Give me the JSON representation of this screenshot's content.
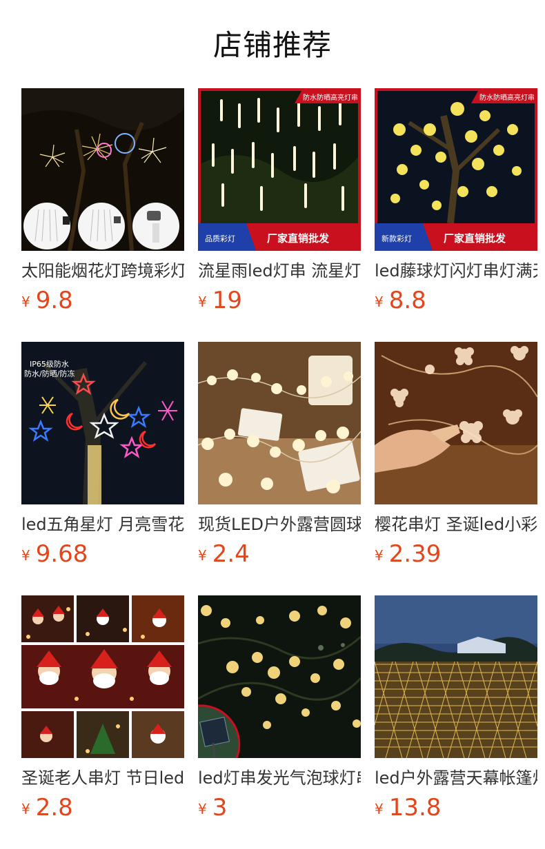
{
  "header": {
    "title": "店铺推荐"
  },
  "colors": {
    "price": "#e2461a",
    "banner_red": "#c8101e",
    "banner_blue": "#1e40a8"
  },
  "products": [
    {
      "name": "太阳能烟花灯跨境彩灯",
      "currency": "¥",
      "price": "9.8",
      "image": "fireworks-lights-photo"
    },
    {
      "name": "流星雨led灯串 流星灯",
      "currency": "¥",
      "price": "19",
      "image": "meteor-rain-lights-photo",
      "top_badge": "防水防晒高亮灯串",
      "bottom_left": "品质彩灯",
      "bottom_right": "厂家直销批发"
    },
    {
      "name": "led藤球灯闪灯串灯满天星",
      "currency": "¥",
      "price": "8.8",
      "image": "rattan-ball-lights-photo",
      "top_badge": "防水防晒高亮灯串",
      "bottom_left": "新款彩灯",
      "bottom_right": "厂家直销批发"
    },
    {
      "name": "led五角星灯 月亮雪花灯",
      "currency": "¥",
      "price": "9.68",
      "image": "star-moon-lights-photo",
      "overlay_text_1": "IP65级防水",
      "overlay_text_2": "防水/防晒/防冻"
    },
    {
      "name": "现货LED户外露营圆球灯",
      "currency": "¥",
      "price": "2.4",
      "image": "ball-string-lights-photo"
    },
    {
      "name": "樱花串灯 圣诞led小彩灯",
      "currency": "¥",
      "price": "2.39",
      "image": "cherry-blossom-lights-photo"
    },
    {
      "name": "圣诞老人串灯 节日led灯",
      "currency": "¥",
      "price": "2.8",
      "image": "santa-string-lights-photo"
    },
    {
      "name": "led灯串发光气泡球灯串",
      "currency": "¥",
      "price": "3",
      "image": "bubble-ball-lights-photo"
    },
    {
      "name": "led户外露营天幕帐篷灯",
      "currency": "¥",
      "price": "13.8",
      "image": "net-lights-photo"
    }
  ]
}
